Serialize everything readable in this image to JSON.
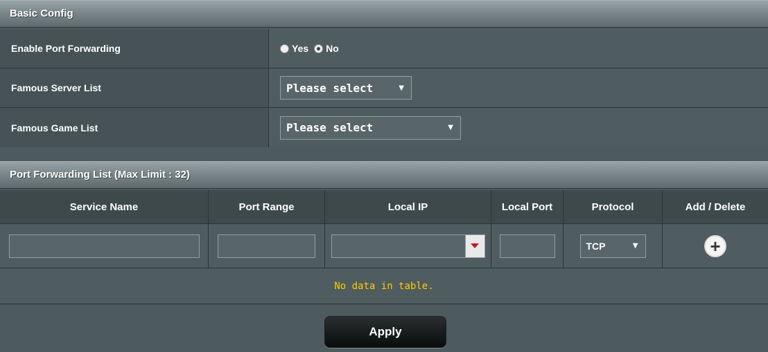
{
  "basic_config": {
    "title": "Basic Config",
    "rows": [
      {
        "label": "Enable Port Forwarding"
      },
      {
        "label": "Famous Server List"
      },
      {
        "label": "Famous Game List"
      }
    ],
    "enable_port_forwarding": {
      "yes_label": "Yes",
      "no_label": "No",
      "selected": "No"
    },
    "famous_server_list": {
      "value": "Please select"
    },
    "famous_game_list": {
      "value": "Please select"
    }
  },
  "port_forwarding_list": {
    "title": "Port Forwarding List (Max Limit : 32)",
    "columns": [
      "Service Name",
      "Port Range",
      "Local IP",
      "Local Port",
      "Protocol",
      "Add / Delete"
    ],
    "input_row": {
      "service_name": "",
      "port_range": "",
      "local_ip": "",
      "local_port": "",
      "protocol": "TCP"
    },
    "empty_message": "No data in table."
  },
  "apply_label": "Apply",
  "icons": {
    "radio": "radio-icon",
    "select_arrow": "triangle-down-icon",
    "add": "plus-circle-icon"
  },
  "colors": {
    "empty_message": "#ffcc00",
    "dropdown_arrow": "#c8171f"
  }
}
